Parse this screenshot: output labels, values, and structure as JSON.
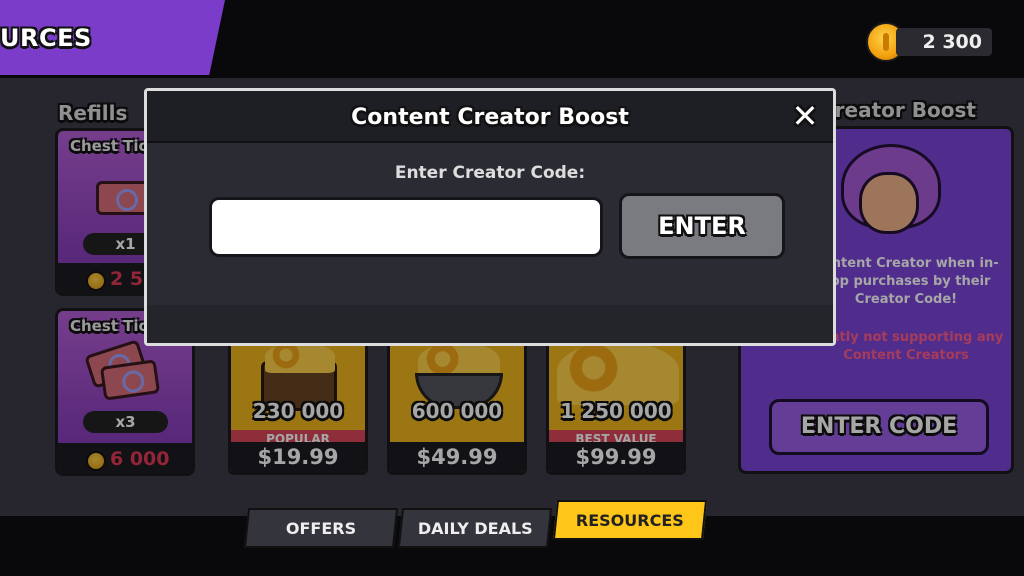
{
  "header": {
    "section_title": "URCES",
    "coins": "2 300"
  },
  "refills": {
    "label": "Refills",
    "cards": [
      {
        "title": "Chest Tic",
        "qty": "x1",
        "price": "2 5"
      },
      {
        "title": "Chest Tic",
        "qty": "x3",
        "price": "6 000"
      }
    ]
  },
  "coin_offers": [
    {
      "amount": "230 000",
      "tag": "POPULAR",
      "price": "$19.99"
    },
    {
      "amount": "600 000",
      "tag": "",
      "price": "$49.99"
    },
    {
      "amount": "1 250 000",
      "tag": "BEST VALUE",
      "price": "$99.99"
    }
  ],
  "creator_boost": {
    "title": "Creator Boost",
    "description": "Content Creator when in-app purchases by their Creator Code!",
    "warning": "rrently not supporting any Content Creators",
    "button": "ENTER CODE"
  },
  "bottom_nav": {
    "tabs": [
      {
        "label": "OFFERS",
        "active": false
      },
      {
        "label": "DAILY DEALS",
        "active": false
      },
      {
        "label": "RESOURCES",
        "active": true
      }
    ]
  },
  "modal": {
    "title": "Content Creator Boost",
    "prompt": "Enter Creator Code:",
    "input_value": "",
    "enter_button": "ENTER",
    "close_icon": "close-icon"
  },
  "colors": {
    "accent_purple": "#7b3cc9",
    "gold": "#ffc61a",
    "price_red": "#e13a55",
    "warning_pink": "#ff5c8a"
  }
}
